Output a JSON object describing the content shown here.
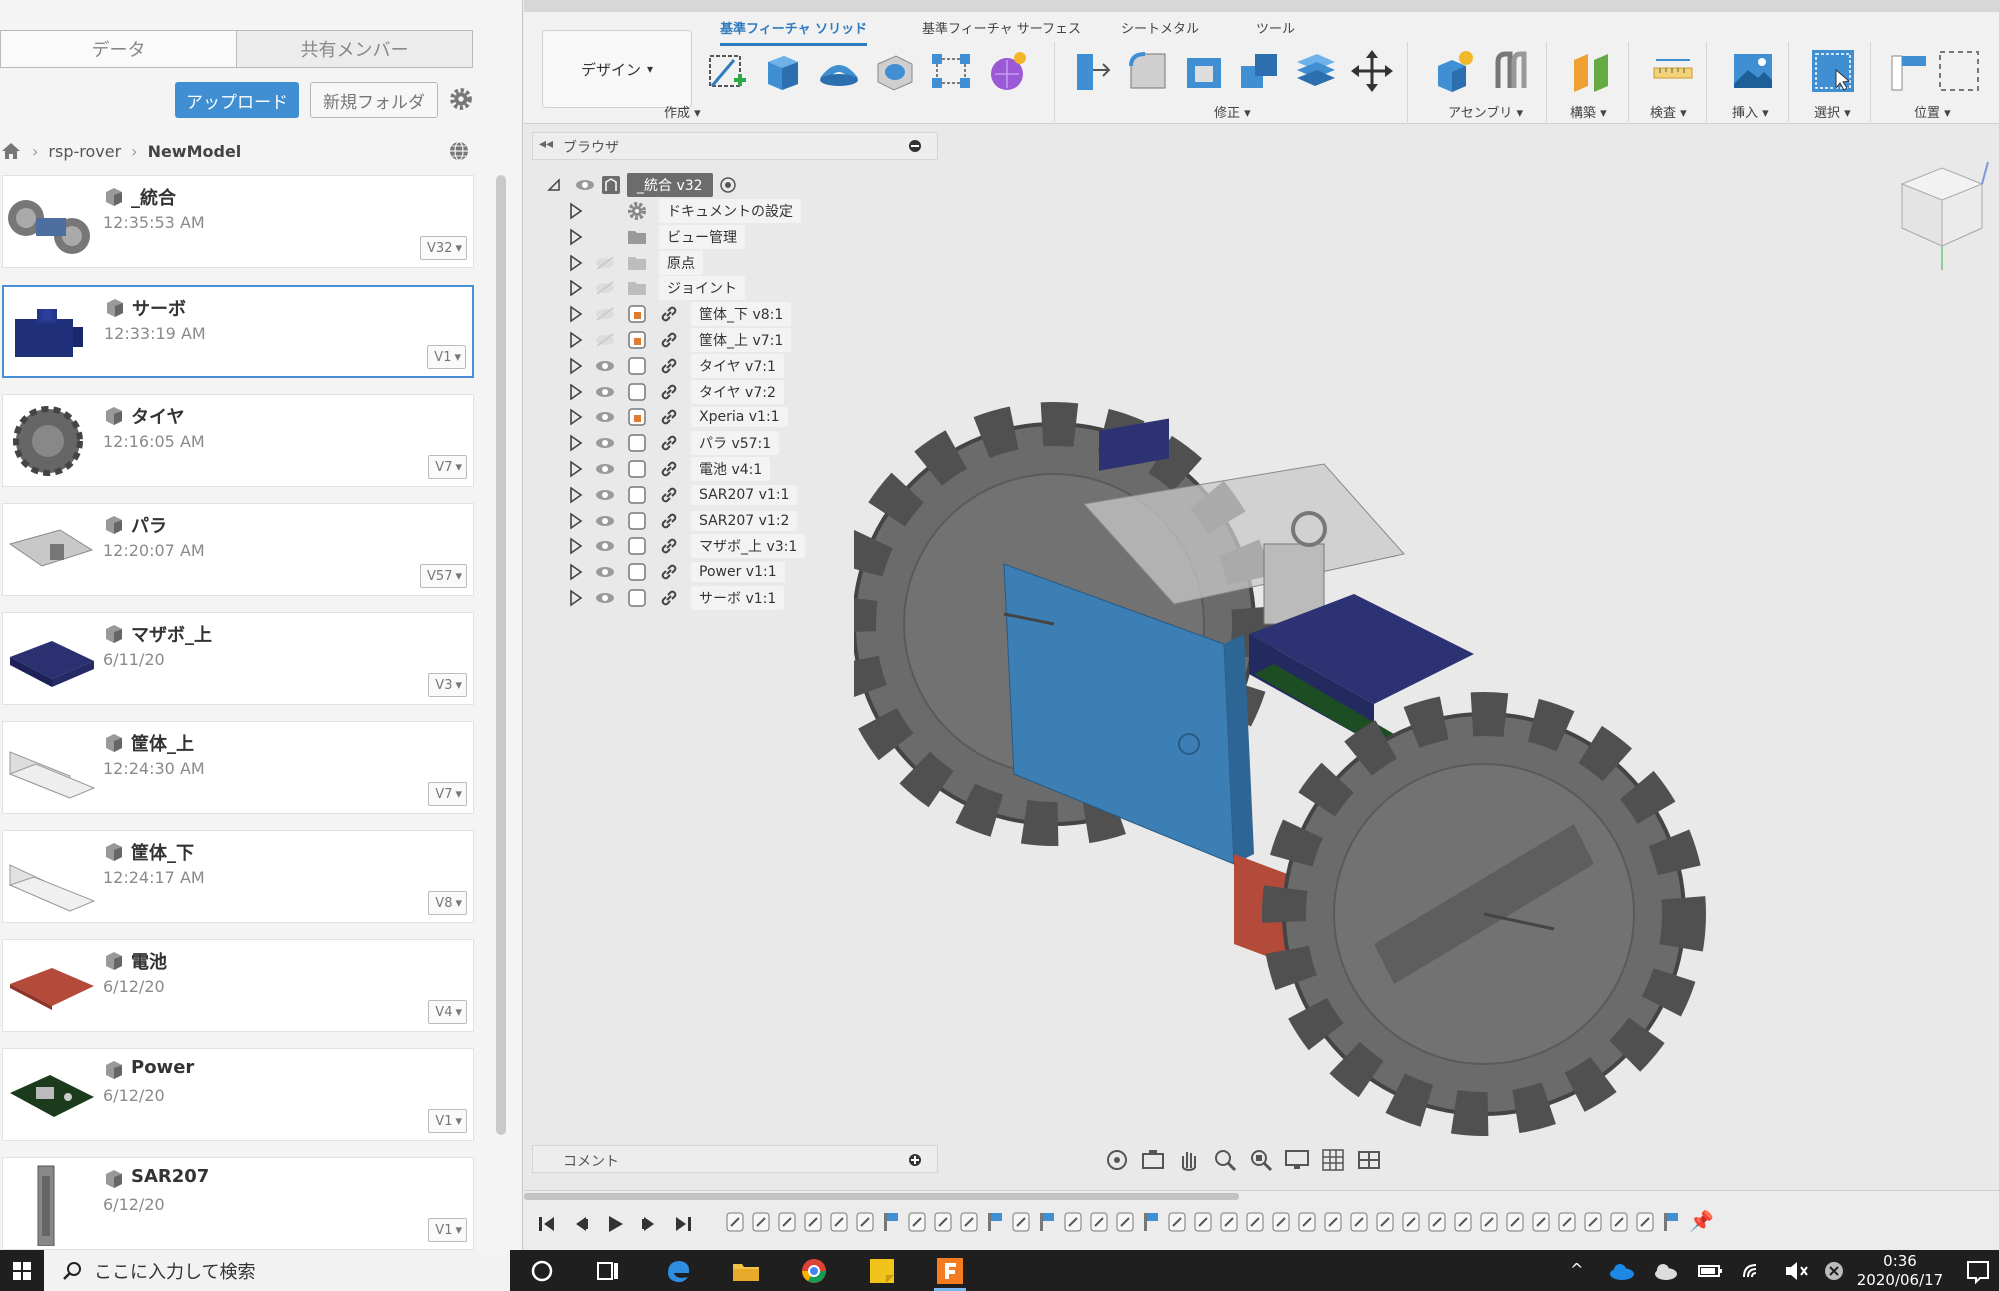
{
  "left_panel": {
    "tabs": [
      "データ",
      "共有メンバー"
    ],
    "upload_label": "アップロード",
    "new_folder_label": "新規フォルダ",
    "breadcrumb": [
      "rsp-rover",
      "NewModel"
    ],
    "files": [
      {
        "name": "_統合",
        "time": "12:35:53 AM",
        "version": "V32"
      },
      {
        "name": "サーボ",
        "time": "12:33:19 AM",
        "version": "V1"
      },
      {
        "name": "タイヤ",
        "time": "12:16:05 AM",
        "version": "V7"
      },
      {
        "name": "パラ",
        "time": "12:20:07 AM",
        "version": "V57"
      },
      {
        "name": "マザボ_上",
        "time": "6/11/20",
        "version": "V3"
      },
      {
        "name": "筐体_上",
        "time": "12:24:30 AM",
        "version": "V7"
      },
      {
        "name": "筐体_下",
        "time": "12:24:17 AM",
        "version": "V8"
      },
      {
        "name": "電池",
        "time": "6/12/20",
        "version": "V4"
      },
      {
        "name": "Power",
        "time": "6/12/20",
        "version": "V1"
      },
      {
        "name": "SAR207",
        "time": "6/12/20",
        "version": "V1"
      }
    ]
  },
  "toolbar": {
    "design_label": "デザイン",
    "tabs": [
      "基準フィーチャ ソリッド",
      "基準フィーチャ サーフェス",
      "シートメタル",
      "ツール"
    ],
    "groups": [
      "作成",
      "修正",
      "アセンブリ",
      "構築",
      "検査",
      "挿入",
      "選択",
      "位置"
    ]
  },
  "browser": {
    "title": "ブラウザ",
    "root": "_統合 v32",
    "items": [
      {
        "label": "ドキュメントの設定",
        "icon": "gear-icon"
      },
      {
        "label": "ビュー管理",
        "icon": "folder-icon"
      },
      {
        "label": "原点",
        "icon": "folder-icon"
      },
      {
        "label": "ジョイント",
        "icon": "folder-icon"
      },
      {
        "label": "筐体_下 v8:1",
        "icon": "component-icon"
      },
      {
        "label": "筐体_上 v7:1",
        "icon": "component-icon"
      },
      {
        "label": "タイヤ v7:1",
        "icon": "component-icon"
      },
      {
        "label": "タイヤ v7:2",
        "icon": "component-icon"
      },
      {
        "label": "Xperia v1:1",
        "icon": "component-icon"
      },
      {
        "label": "パラ v57:1",
        "icon": "component-icon"
      },
      {
        "label": "電池 v4:1",
        "icon": "component-icon"
      },
      {
        "label": "SAR207 v1:1",
        "icon": "component-icon"
      },
      {
        "label": "SAR207 v1:2",
        "icon": "component-icon"
      },
      {
        "label": "マザボ_上 v3:1",
        "icon": "component-icon"
      },
      {
        "label": "Power v1:1",
        "icon": "component-icon"
      },
      {
        "label": "サーボ v1:1",
        "icon": "component-icon"
      }
    ]
  },
  "comments": {
    "title": "コメント"
  },
  "taskbar": {
    "search_placeholder": "ここに入力して検索",
    "time": "0:36",
    "date": "2020/06/17"
  },
  "colors": {
    "accent": "#3f8fd2",
    "phone_blue": "#3c7fb5",
    "battery_red": "#b34a3a",
    "board_navy": "#2d3372",
    "wheel_gray": "#6b6b6b"
  }
}
